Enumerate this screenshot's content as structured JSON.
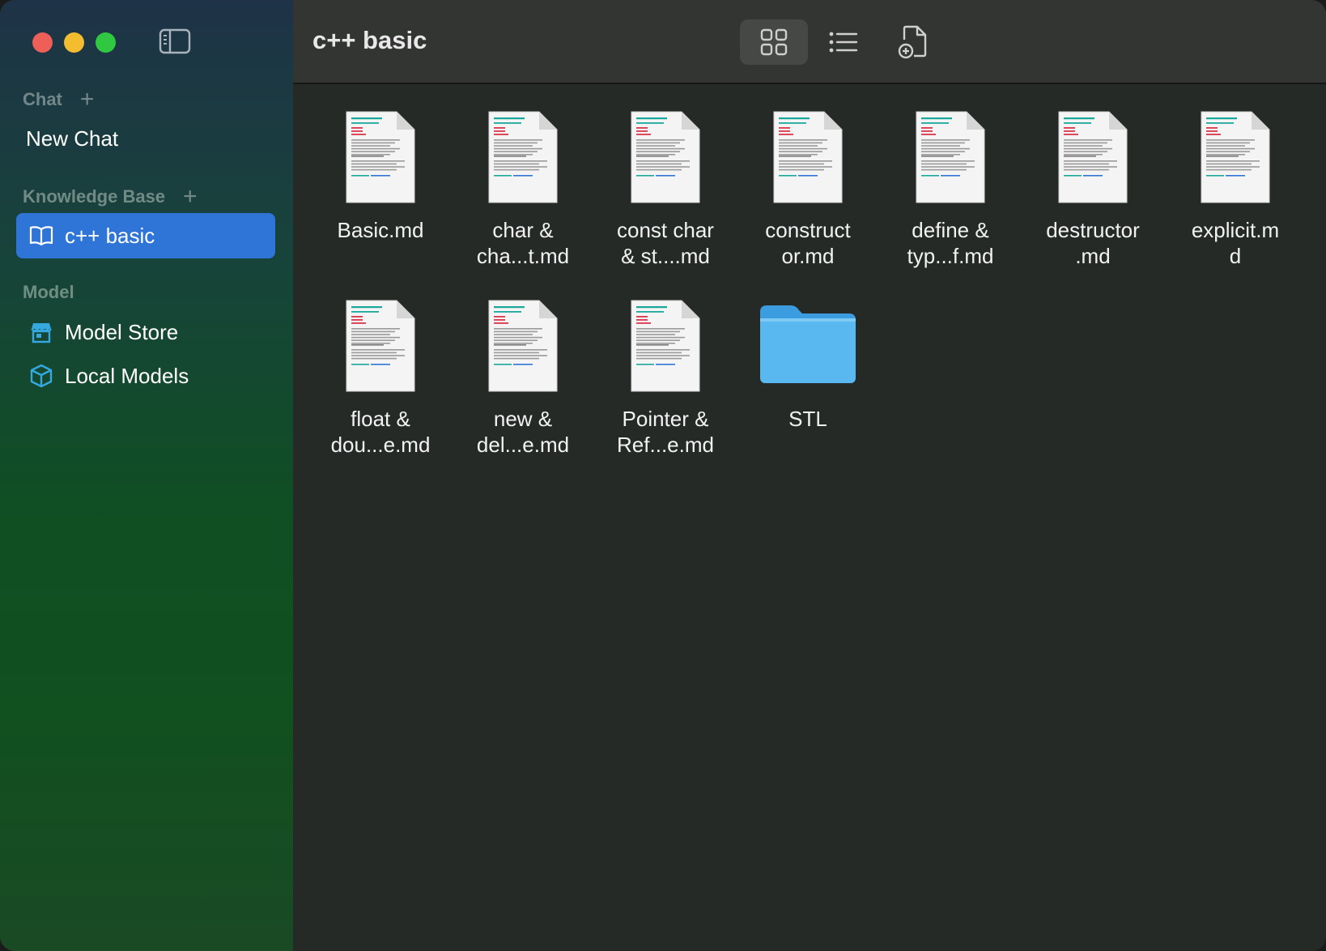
{
  "sidebar": {
    "chat_section": {
      "label": "Chat",
      "add": "+"
    },
    "new_chat": "New Chat",
    "kb_section": {
      "label": "Knowledge Base",
      "add": "+"
    },
    "kb_items": [
      {
        "label": "c++ basic",
        "active": true
      }
    ],
    "model_section": {
      "label": "Model"
    },
    "model_store": "Model Store",
    "local_models": "Local Models"
  },
  "header": {
    "title": "c++ basic",
    "view_mode": "grid"
  },
  "files": [
    {
      "name": "Basic.md",
      "line1": "Basic.md",
      "line2": "",
      "kind": "document"
    },
    {
      "name": "char & cha...t.md",
      "line1": "char &",
      "line2": "cha...t.md",
      "kind": "document"
    },
    {
      "name": "const char & st....md",
      "line1": "const char",
      "line2": "& st....md",
      "kind": "document"
    },
    {
      "name": "constructor.md",
      "line1": "construct",
      "line2": "or.md",
      "kind": "document"
    },
    {
      "name": "define & typ...f.md",
      "line1": "define &",
      "line2": "typ...f.md",
      "kind": "document"
    },
    {
      "name": "destructor.md",
      "line1": "destructor",
      "line2": ".md",
      "kind": "document"
    },
    {
      "name": "explicit.md",
      "line1": "explicit.m",
      "line2": "d",
      "kind": "document"
    },
    {
      "name": "float & dou...e.md",
      "line1": "float &",
      "line2": "dou...e.md",
      "kind": "document"
    },
    {
      "name": "new & del...e.md",
      "line1": "new &",
      "line2": "del...e.md",
      "kind": "document"
    },
    {
      "name": "Pointer & Ref...e.md",
      "line1": "Pointer &",
      "line2": "Ref...e.md",
      "kind": "document"
    },
    {
      "name": "STL",
      "line1": "STL",
      "line2": "",
      "kind": "folder"
    }
  ],
  "colors": {
    "accent": "#2f74d7",
    "folder": "#5ab8f0",
    "preview_heading": "#1aa89a",
    "preview_red": "#d8364a"
  },
  "icons": {
    "sidebar_toggle": "sidebar-toggle-icon",
    "grid_view": "grid-view-icon",
    "list_view": "list-view-icon",
    "add_file": "add-file-icon",
    "book": "book-icon",
    "store": "store-icon",
    "cube": "cube-icon"
  }
}
